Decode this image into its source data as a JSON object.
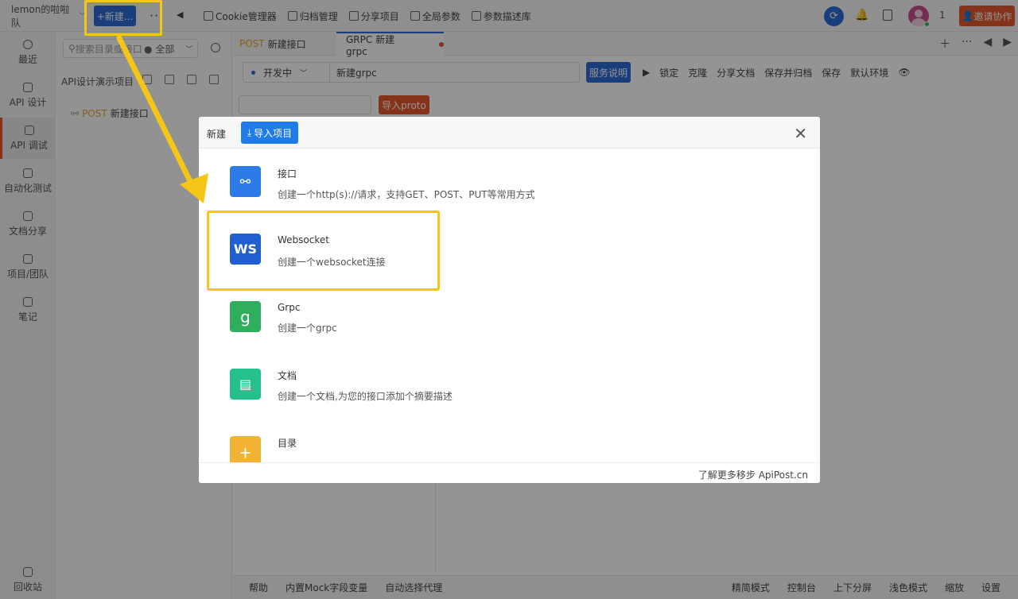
{
  "topbar": {
    "team": "lemon的啦啦队",
    "new_label": "+新建...",
    "more": "···",
    "tools": [
      "Cookie管理器",
      "归档管理",
      "分享项目",
      "全局参数",
      "参数描述库"
    ],
    "count": "1",
    "invite": "邀请协作"
  },
  "sidebar": {
    "items": [
      "最近",
      "API 设计",
      "API 调试",
      "自动化测试",
      "文档分享",
      "项目/团队",
      "笔记"
    ],
    "bottom": "回收站"
  },
  "tree": {
    "search_placeholder": "搜索目录或接口",
    "filter": "● 全部",
    "project": "API设计演示项目",
    "node_method": "POST",
    "node_name": "新建接口"
  },
  "tabs": [
    {
      "method": "POST",
      "name": "新建接口"
    },
    {
      "method": "",
      "name": "GRPC 新建grpc"
    }
  ],
  "request": {
    "env": "开发中",
    "name": "新建grpc",
    "service_btn": "服务说明",
    "tools": [
      "▶",
      "锁定",
      "克隆",
      "分享文档",
      "保存并归档",
      "保存",
      "默认环境"
    ],
    "proto_btn": "导入proto"
  },
  "bottombar": {
    "left": [
      "帮助",
      "内置Mock字段变量",
      "自动选择代理"
    ],
    "right": [
      "精简模式",
      "控制台",
      "上下分屏",
      "浅色模式",
      "缩放",
      "设置"
    ]
  },
  "modal": {
    "title": "新建",
    "import_label": "导入项目",
    "options": [
      {
        "title": "接口",
        "desc": "创建一个http(s)://请求，支持GET、POST、PUT等常用方式",
        "icon": "link-icon",
        "color": "#2d7be8"
      },
      {
        "title": "Websocket",
        "desc": "创建一个websocket连接",
        "icon": "WS",
        "color": "#1f5fd0"
      },
      {
        "title": "Grpc",
        "desc": "创建一个grpc",
        "icon": "g",
        "color": "#2fae5d"
      },
      {
        "title": "文档",
        "desc": "创建一个文档,为您的接口添加个摘要描述",
        "icon": "doc-icon",
        "color": "#26c08f"
      },
      {
        "title": "目录",
        "desc": "",
        "icon": "folder-icon",
        "color": "#f2b233"
      }
    ],
    "footer": "了解更多移步 ApiPost.cn"
  }
}
